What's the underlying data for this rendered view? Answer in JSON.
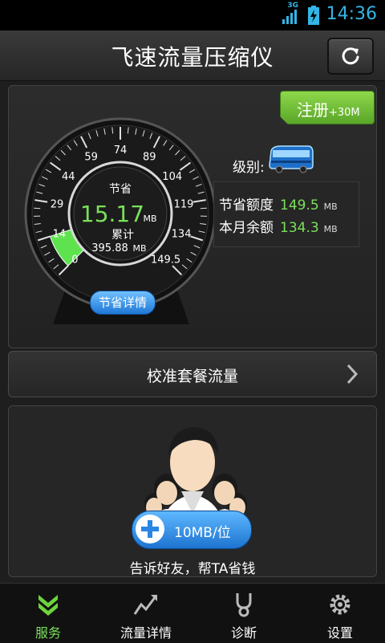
{
  "status_bar": {
    "network": "3G",
    "time": "14:36"
  },
  "title_bar": {
    "title": "飞速流量压缩仪",
    "refresh_icon": "refresh-icon"
  },
  "register": {
    "label": "注册",
    "bonus": "+30M"
  },
  "gauge": {
    "ticks": [
      "0",
      "14",
      "29",
      "44",
      "59",
      "74",
      "89",
      "104",
      "119",
      "134",
      "149.5"
    ],
    "saved_label": "节省",
    "saved_value": "15.17",
    "saved_unit": "MB",
    "total_label": "累计",
    "total_value": "395.88",
    "total_unit": "MB",
    "fill_level": 0.1,
    "detail_button": "节省详情"
  },
  "level": {
    "label": "级别:",
    "icon": "bus-icon"
  },
  "stats": {
    "saved_quota_label": "节省额度",
    "saved_quota_value": "149.5",
    "saved_quota_unit": "MB",
    "remaining_label": "本月余额",
    "remaining_value": "134.3",
    "remaining_unit": "MB"
  },
  "calibrate": {
    "label": "校准套餐流量"
  },
  "invite": {
    "pill_text": "10MB/位",
    "caption": "告诉好友，帮TA省钱"
  },
  "nav": {
    "items": [
      {
        "label": "服务",
        "icon": "download-arrow-icon",
        "active": true
      },
      {
        "label": "流量详情",
        "icon": "trend-icon",
        "active": false
      },
      {
        "label": "诊断",
        "icon": "stethoscope-icon",
        "active": false
      },
      {
        "label": "设置",
        "icon": "gear-icon",
        "active": false
      }
    ]
  },
  "colors": {
    "accent_green": "#7be05a",
    "accent_blue": "#33b5e5",
    "button_blue": "#1f77d6"
  }
}
